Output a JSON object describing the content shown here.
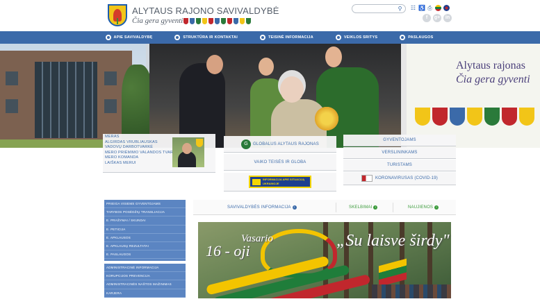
{
  "header": {
    "title": "ALYTAUS RAJONO SAVIVALDYBĖ",
    "slogan": "Čia gera gyventi!",
    "search": {
      "value": "",
      "placeholder": ""
    },
    "icons": [
      "search-icon",
      "sitemap-icon",
      "accessibility-icon",
      "print-icon",
      "lithuanian-flag-icon",
      "english-flag-icon"
    ],
    "social": [
      "f",
      "g+",
      "in"
    ],
    "colors": {
      "primary": "#3b6aa9",
      "green": "#3a9a3a",
      "yellow": "#f2c518"
    }
  },
  "nav": {
    "items": [
      {
        "label": "APIE SAVIVALDYBĘ"
      },
      {
        "label": "STRUKTŪRA IR KONTAKTAI"
      },
      {
        "label": "TEISINĖ INFORMACIJA"
      },
      {
        "label": "VEIKLOS SRITYS"
      },
      {
        "label": "PASLAUGOS"
      }
    ]
  },
  "hero": {
    "banner_title": "Alytaus rajonas",
    "banner_slogan": "Čia gera gyventi"
  },
  "mayor": {
    "links": [
      "MERAS",
      "ALGIRDAS VRUBLIAUSKAS",
      "VADOVŲ DARBOTVARKĖ",
      "MERO PRIĖMIMO VALANDOS TVARKA",
      "MERO KOMANDA",
      "LAIŠKAS MERUI"
    ]
  },
  "center_tabs": {
    "globalus": "GLOBALUS ALYTAUS RAJONAS",
    "vaiko": "VAIKO TEISĖS IR GLOBA",
    "info_badge": "INFORMACIJA APIE SITUACIJĄ UKRAINOJE"
  },
  "right_tabs": [
    "GYVENTOJAMS",
    "VERSLININKAMS",
    "TURISTAMS",
    "KORONAVIRUSAS (COVID-19)"
  ],
  "left_menu": {
    "group1": [
      "PRIEIGA VISIEMS GYVENTOJAMS",
      "TARYBOS POSĖDŽIŲ TRANSLIACIJA",
      "E. PRAŠYMAI / SKUNDAI",
      "E. PETICIJA",
      "E. APKLAUSOS",
      "E. APKLAUSŲ REZULTATAI",
      "E. PASLAUGOS"
    ],
    "group2": [
      "ADMINISTRACINĖ INFORMACIJA",
      "KORUPCIJOS PREVENCIJA",
      "ADMINISTRACINĖS NAŠTOS MAŽINIMAS",
      "KARJERA"
    ]
  },
  "info_tabs": {
    "tab1": "SAVIVALDYBĖS INFORMACIJA",
    "tab2": "SKELBIMAI",
    "tab3": "NAUJIENOS"
  },
  "feature_banner": {
    "vasario": "Vasario",
    "day": "16 - oji",
    "slogan": "„Su laisve širdy\""
  }
}
